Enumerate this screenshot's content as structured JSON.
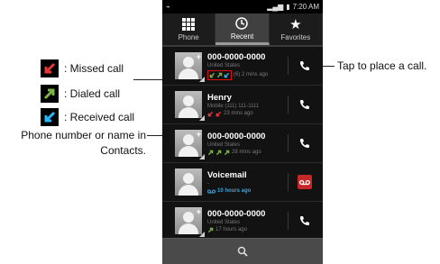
{
  "legend": {
    "missed": ": Missed call",
    "dialed": ": Dialed call",
    "received": ": Received call"
  },
  "callouts": {
    "left": "Phone number or name in Contacts.",
    "right": "Tap to place a call."
  },
  "status_bar": {
    "time": "7:20 AM"
  },
  "tabs": [
    {
      "label": "Phone",
      "icon": "grid-icon"
    },
    {
      "label": "Recent",
      "icon": "clock-icon",
      "active": true
    },
    {
      "label": "Favorites",
      "icon": "star-icon"
    }
  ],
  "calls": [
    {
      "name": "000-0000-0000",
      "sub": "United States",
      "meta": "(6) 2 mins ago",
      "action": "call"
    },
    {
      "name": "Henry",
      "sub": "Mobile (111) 111-1111",
      "meta": "23 mins ago",
      "action": "call"
    },
    {
      "name": "000-0000-0000",
      "sub": "United States",
      "meta": "28 mins ago",
      "action": "call"
    },
    {
      "name": "Voicemail",
      "sub": "-",
      "meta": "10 hours ago",
      "action": "voicemail"
    },
    {
      "name": "000-0000-0000",
      "sub": "United States",
      "meta": "17 hours ago",
      "action": "call"
    }
  ],
  "colors": {
    "missed": "#e53935",
    "dialed": "#7cb342",
    "received": "#29b6f6"
  }
}
